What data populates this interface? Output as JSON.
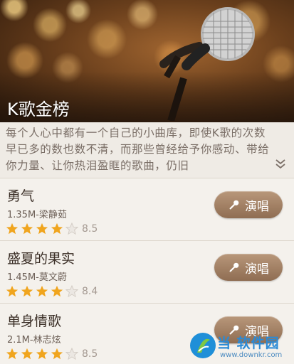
{
  "hero": {
    "title": "K歌金榜"
  },
  "description": {
    "text": "每个人心中都有一个自己的小曲库，即使K歌的次数早已多的数也数不清，而那些曾经给予你感动、带给你力量、让你热泪盈眶的歌曲，仍旧"
  },
  "songs": [
    {
      "name": "勇气",
      "meta": "1.35M-梁静茹",
      "rating_stars": 4,
      "score": "8.5",
      "button": "演唱"
    },
    {
      "name": "盛夏的果实",
      "meta": "1.45M-莫文蔚",
      "rating_stars": 4,
      "score": "8.4",
      "button": "演唱"
    },
    {
      "name": "单身情歌",
      "meta": "2.1M-林志炫",
      "rating_stars": 4,
      "score": "8.5",
      "button": "演唱"
    }
  ],
  "watermark": {
    "brand": "当 软件园",
    "url": "www.downkr.com"
  },
  "colors": {
    "button": "#9b7a5e",
    "star_filled": "#f0a51e",
    "star_empty": "#d8d2cc",
    "background": "#f4f1ec"
  }
}
